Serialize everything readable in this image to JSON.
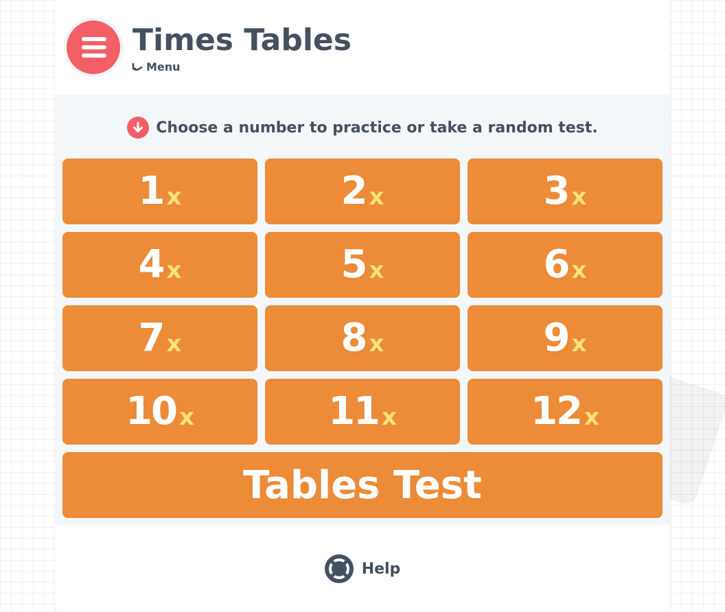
{
  "header": {
    "title": "Times Tables",
    "menu_label": "Menu"
  },
  "instruction": "Choose a number to practice or take a random test.",
  "tables": [
    {
      "number": "1",
      "suffix": "x"
    },
    {
      "number": "2",
      "suffix": "x"
    },
    {
      "number": "3",
      "suffix": "x"
    },
    {
      "number": "4",
      "suffix": "x"
    },
    {
      "number": "5",
      "suffix": "x"
    },
    {
      "number": "6",
      "suffix": "x"
    },
    {
      "number": "7",
      "suffix": "x"
    },
    {
      "number": "8",
      "suffix": "x"
    },
    {
      "number": "9",
      "suffix": "x"
    },
    {
      "number": "10",
      "suffix": "x"
    },
    {
      "number": "11",
      "suffix": "x"
    },
    {
      "number": "12",
      "suffix": "x"
    }
  ],
  "test_button": "Tables Test",
  "help_label": "Help",
  "icons": {
    "menu": "hamburger-icon",
    "menu_link": "return-arrow-icon",
    "instruction": "arrow-down-circle-icon",
    "help": "lifebuoy-icon"
  },
  "colors": {
    "accent": "#f25f66",
    "button": "#ec8b38",
    "multiplier": "#fbe27a",
    "text": "#44505f",
    "panel": "#f3f7fa"
  }
}
